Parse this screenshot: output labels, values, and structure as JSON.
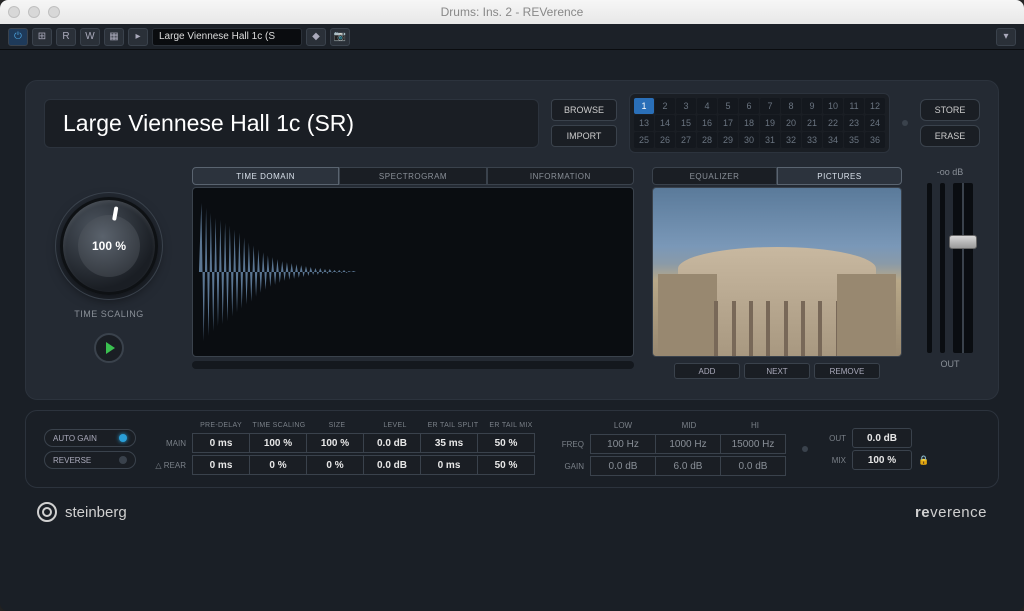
{
  "window": {
    "title": "Drums: Ins. 2 - REVerence"
  },
  "toolbar": {
    "preset_display": "Large Viennese Hall 1c (S"
  },
  "preset": {
    "name": "Large Viennese Hall 1c (SR)",
    "browse": "BROWSE",
    "import": "IMPORT",
    "store": "STORE",
    "erase": "ERASE"
  },
  "slots": {
    "count": 36,
    "active": 1
  },
  "time_scaling": {
    "value": "100 %",
    "label": "TIME SCALING"
  },
  "viz_tabs": {
    "time_domain": "TIME DOMAIN",
    "spectrogram": "SPECTROGRAM",
    "information": "INFORMATION",
    "active": "time_domain"
  },
  "pic_tabs": {
    "equalizer": "EQUALIZER",
    "pictures": "PICTURES",
    "active": "pictures"
  },
  "pic_buttons": {
    "add": "ADD",
    "next": "NEXT",
    "remove": "REMOVE"
  },
  "output": {
    "db_display": "-oo dB",
    "label": "OUT"
  },
  "toggles": {
    "auto_gain": "AUTO GAIN",
    "auto_gain_on": true,
    "reverse": "REVERSE",
    "reverse_on": false
  },
  "params": {
    "headers": [
      "PRE-DELAY",
      "TIME SCALING",
      "SIZE",
      "LEVEL",
      "ER TAIL SPLIT",
      "ER TAIL MIX"
    ],
    "main_label": "MAIN",
    "rear_label": "△ REAR",
    "main": [
      "0 ms",
      "100 %",
      "100 %",
      "0.0 dB",
      "35 ms",
      "50 %"
    ],
    "rear": [
      "0 ms",
      "0 %",
      "0 %",
      "0.0 dB",
      "0 ms",
      "50 %"
    ]
  },
  "eq": {
    "headers": [
      "LOW",
      "MID",
      "HI"
    ],
    "freq_label": "FREQ",
    "gain_label": "GAIN",
    "freq": [
      "100 Hz",
      "1000 Hz",
      "15000 Hz"
    ],
    "gain": [
      "0.0 dB",
      "6.0 dB",
      "0.0 dB"
    ]
  },
  "out_mix": {
    "out_label": "OUT",
    "out_value": "0.0 dB",
    "mix_label": "MIX",
    "mix_value": "100 %"
  },
  "footer": {
    "brand": "steinberg",
    "product_a": "re",
    "product_b": "verence"
  }
}
